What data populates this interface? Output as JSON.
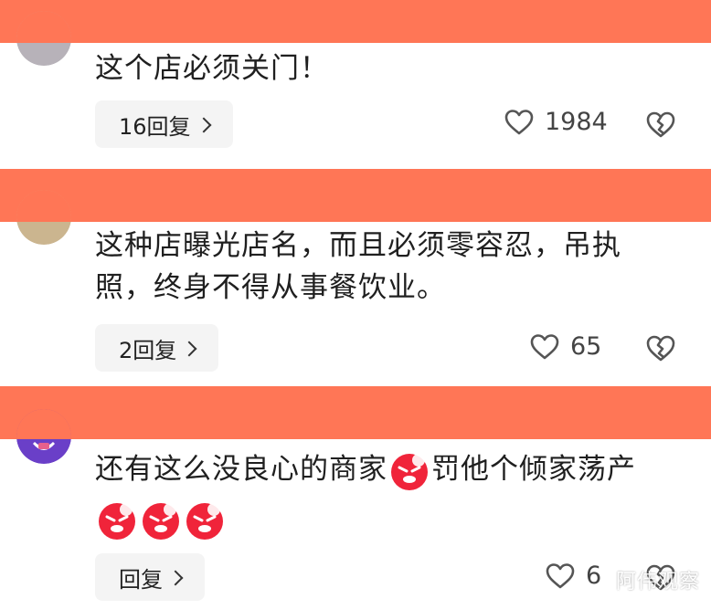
{
  "colors": {
    "band": "#ff7656",
    "reply_bg": "#f4f4f4",
    "text": "#1f1f1f",
    "icon": "#444444"
  },
  "comments": [
    {
      "text": "这个店必须关门！",
      "reply_label": "16回复",
      "likes": "1984",
      "avatar_icon": "avatar-grey"
    },
    {
      "text_line1": "这种店曝光店名，而且必须零容忍，吊执",
      "text_line2": "照，终身不得从事餐饮业。",
      "reply_label": "2回复",
      "likes": "65",
      "avatar_icon": "avatar-tan"
    },
    {
      "text_part1": "还有这么没良心的商家",
      "text_part2": "罚他个倾家荡产",
      "reply_label": "回复",
      "likes": "6",
      "avatar_icon": "avatar-purple",
      "emoji_icon": "angry-face-emoji"
    }
  ],
  "watermark": "阿伟观察"
}
